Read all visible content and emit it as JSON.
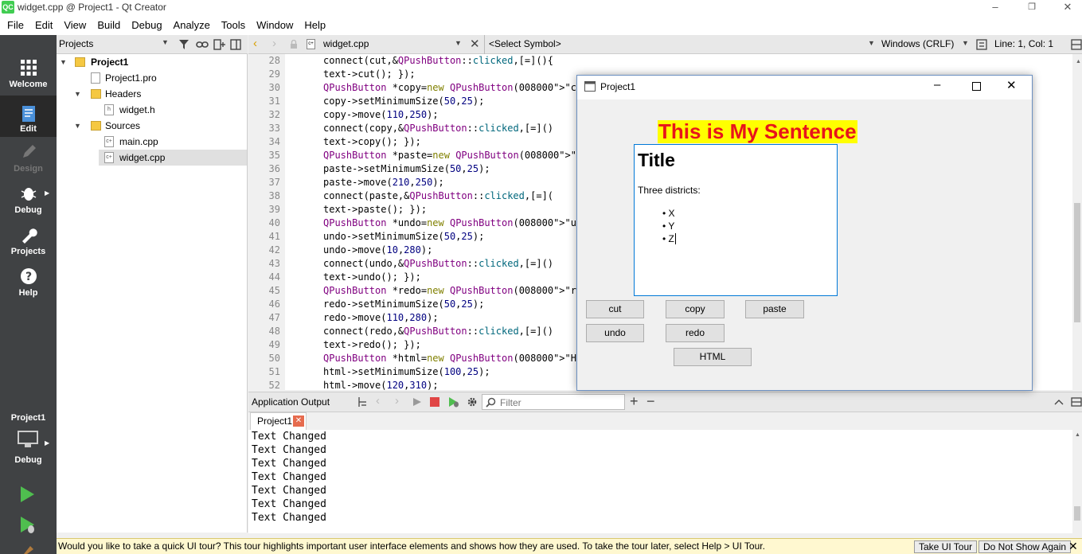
{
  "window": {
    "title": "widget.cpp @ Project1 - Qt Creator",
    "logo": "QC",
    "controls": {
      "minimize": "–",
      "restore": "❐",
      "close": "✕"
    }
  },
  "menu": [
    "File",
    "Edit",
    "View",
    "Build",
    "Debug",
    "Analyze",
    "Tools",
    "Window",
    "Help"
  ],
  "modes": [
    {
      "label": "Welcome",
      "icon": "grid-icon"
    },
    {
      "label": "Edit",
      "icon": "document-icon",
      "selected": true
    },
    {
      "label": "Design",
      "icon": "pen-icon",
      "disabled": true
    },
    {
      "label": "Debug",
      "icon": "bug-icon"
    },
    {
      "label": "Projects",
      "icon": "wrench-icon"
    },
    {
      "label": "Help",
      "icon": "help-icon"
    }
  ],
  "run_target": {
    "project": "Project1",
    "mode": "Debug"
  },
  "projects_pane": {
    "title": "Projects",
    "tree": [
      {
        "label": "Project1",
        "bold": true
      },
      {
        "label": "Project1.pro"
      },
      {
        "label": "Headers"
      },
      {
        "label": "widget.h"
      },
      {
        "label": "Sources"
      },
      {
        "label": "main.cpp"
      },
      {
        "label": "widget.cpp",
        "selected": true
      }
    ]
  },
  "editor_toolbar": {
    "file": "widget.cpp",
    "symbol": "<Select Symbol>",
    "line_ending": "Windows (CRLF)",
    "position": "Line: 1, Col: 1"
  },
  "editor": {
    "lines": [
      {
        "n": "28",
        "code": "connect(cut,&QPushButton::clicked,[=](){"
      },
      {
        "n": "29",
        "code": "text->cut(); });"
      },
      {
        "n": "30",
        "code": "QPushButton *copy=new QPushButton(\"copy\""
      },
      {
        "n": "31",
        "code": "copy->setMinimumSize(50,25);"
      },
      {
        "n": "32",
        "code": "copy->move(110,250);"
      },
      {
        "n": "33",
        "code": "connect(copy,&QPushButton::clicked,[=]()"
      },
      {
        "n": "34",
        "code": "text->copy(); });"
      },
      {
        "n": "35",
        "code": "QPushButton *paste=new QPushButton(\"past"
      },
      {
        "n": "36",
        "code": "paste->setMinimumSize(50,25);"
      },
      {
        "n": "37",
        "code": "paste->move(210,250);"
      },
      {
        "n": "38",
        "code": "connect(paste,&QPushButton::clicked,[=]("
      },
      {
        "n": "39",
        "code": "text->paste(); });"
      },
      {
        "n": "40",
        "code": "QPushButton *undo=new QPushButton(\"undo\""
      },
      {
        "n": "41",
        "code": "undo->setMinimumSize(50,25);"
      },
      {
        "n": "42",
        "code": "undo->move(10,280);"
      },
      {
        "n": "43",
        "code": "connect(undo,&QPushButton::clicked,[=]()"
      },
      {
        "n": "44",
        "code": "text->undo(); });"
      },
      {
        "n": "45",
        "code": "QPushButton *redo=new QPushButton(\"redo\""
      },
      {
        "n": "46",
        "code": "redo->setMinimumSize(50,25);"
      },
      {
        "n": "47",
        "code": "redo->move(110,280);"
      },
      {
        "n": "48",
        "code": "connect(redo,&QPushButton::clicked,[=]()"
      },
      {
        "n": "49",
        "code": "text->redo(); });"
      },
      {
        "n": "50",
        "code": "QPushButton *html=new QPushButton(\"HTML\""
      },
      {
        "n": "51",
        "code": "html->setMinimumSize(100,25);"
      },
      {
        "n": "52",
        "code": "html->move(120,310);"
      }
    ]
  },
  "output": {
    "title": "Application Output",
    "filter_placeholder": "Filter",
    "tab": "Project1",
    "lines": [
      "Text Changed",
      "Text Changed",
      "Text Changed",
      "Text Changed",
      "Text Changed",
      "Text Changed",
      "Text Changed"
    ]
  },
  "tour": {
    "message": "Would you like to take a quick UI tour? This tour highlights important user interface elements and shows how they are used. To take the tour later, select Help > UI Tour.",
    "take": "Take UI Tour",
    "dismiss": "Do Not Show Again"
  },
  "app_window": {
    "title": "Project1",
    "label": "This is My Sentence",
    "label_color": "#e8141b",
    "label_bg": "#ffff00",
    "rich_text": {
      "heading": "Title",
      "para": "Three districts:",
      "items": [
        "X",
        "Y",
        "Z"
      ]
    },
    "buttons": {
      "cut": "cut",
      "copy": "copy",
      "paste": "paste",
      "undo": "undo",
      "redo": "redo",
      "html": "HTML"
    }
  }
}
